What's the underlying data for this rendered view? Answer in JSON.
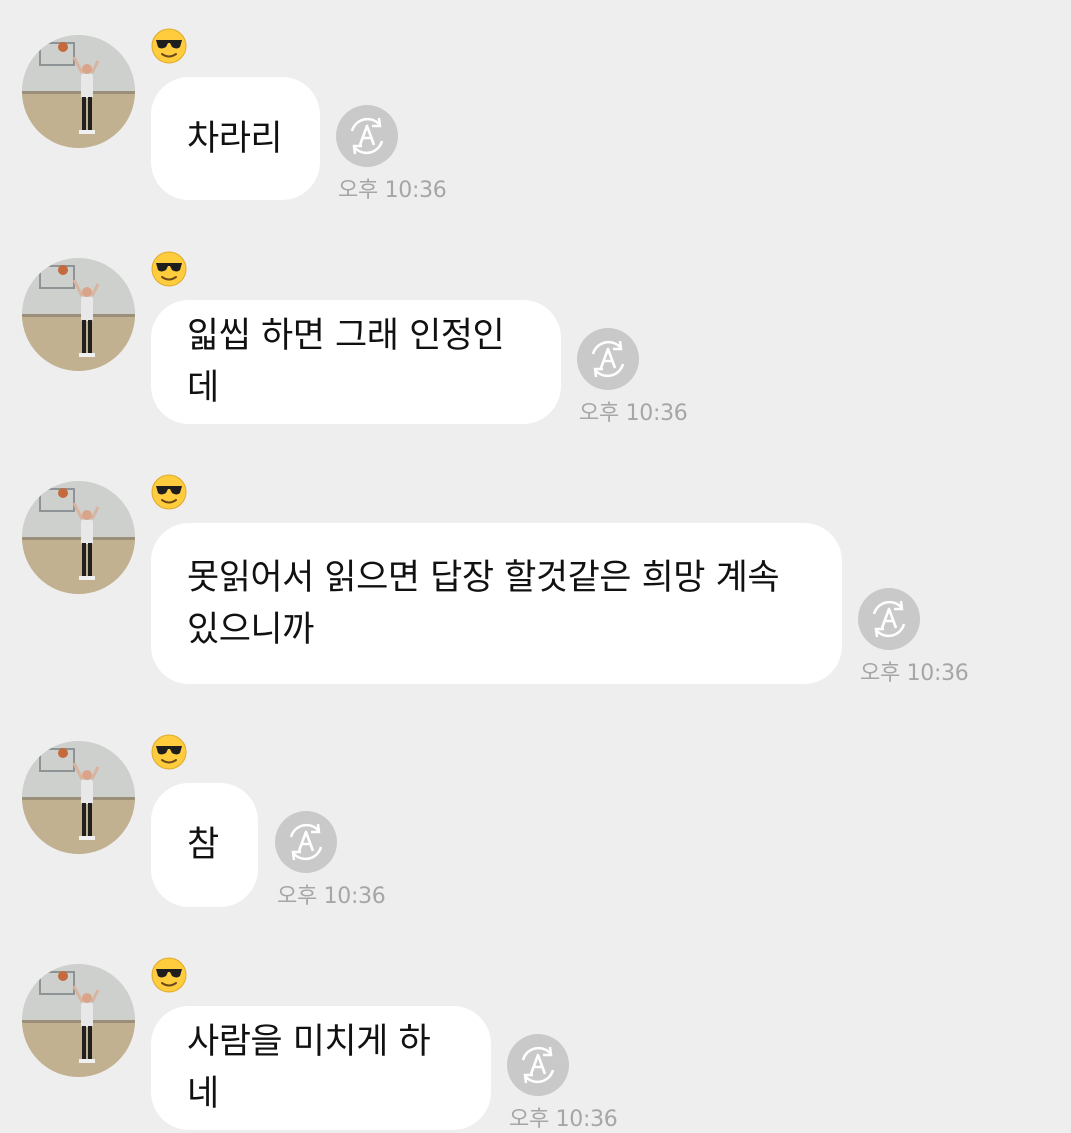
{
  "theme": {
    "background": "#eeeeee",
    "bubble": "#ffffff",
    "text": "#111111",
    "timestamp": "#a6a6a6",
    "icon": "#c6c6c6"
  },
  "sender": {
    "avatar_icon": "profile-photo-basketball-player",
    "name_emoji": "😎"
  },
  "messages": [
    {
      "lines": [
        "차라리"
      ],
      "time": "오후 10:36"
    },
    {
      "lines": [
        "읿씹 하면 그래 인정인데"
      ],
      "time": "오후 10:36"
    },
    {
      "lines": [
        "못읽어서 읽으면 답장 할것같은 희망 계속",
        "있으니까"
      ],
      "time": "오후 10:36"
    },
    {
      "lines": [
        "참"
      ],
      "time": "오후 10:36"
    },
    {
      "lines": [
        "사람을 미치게 하네"
      ],
      "time": "오후 10:36"
    }
  ]
}
